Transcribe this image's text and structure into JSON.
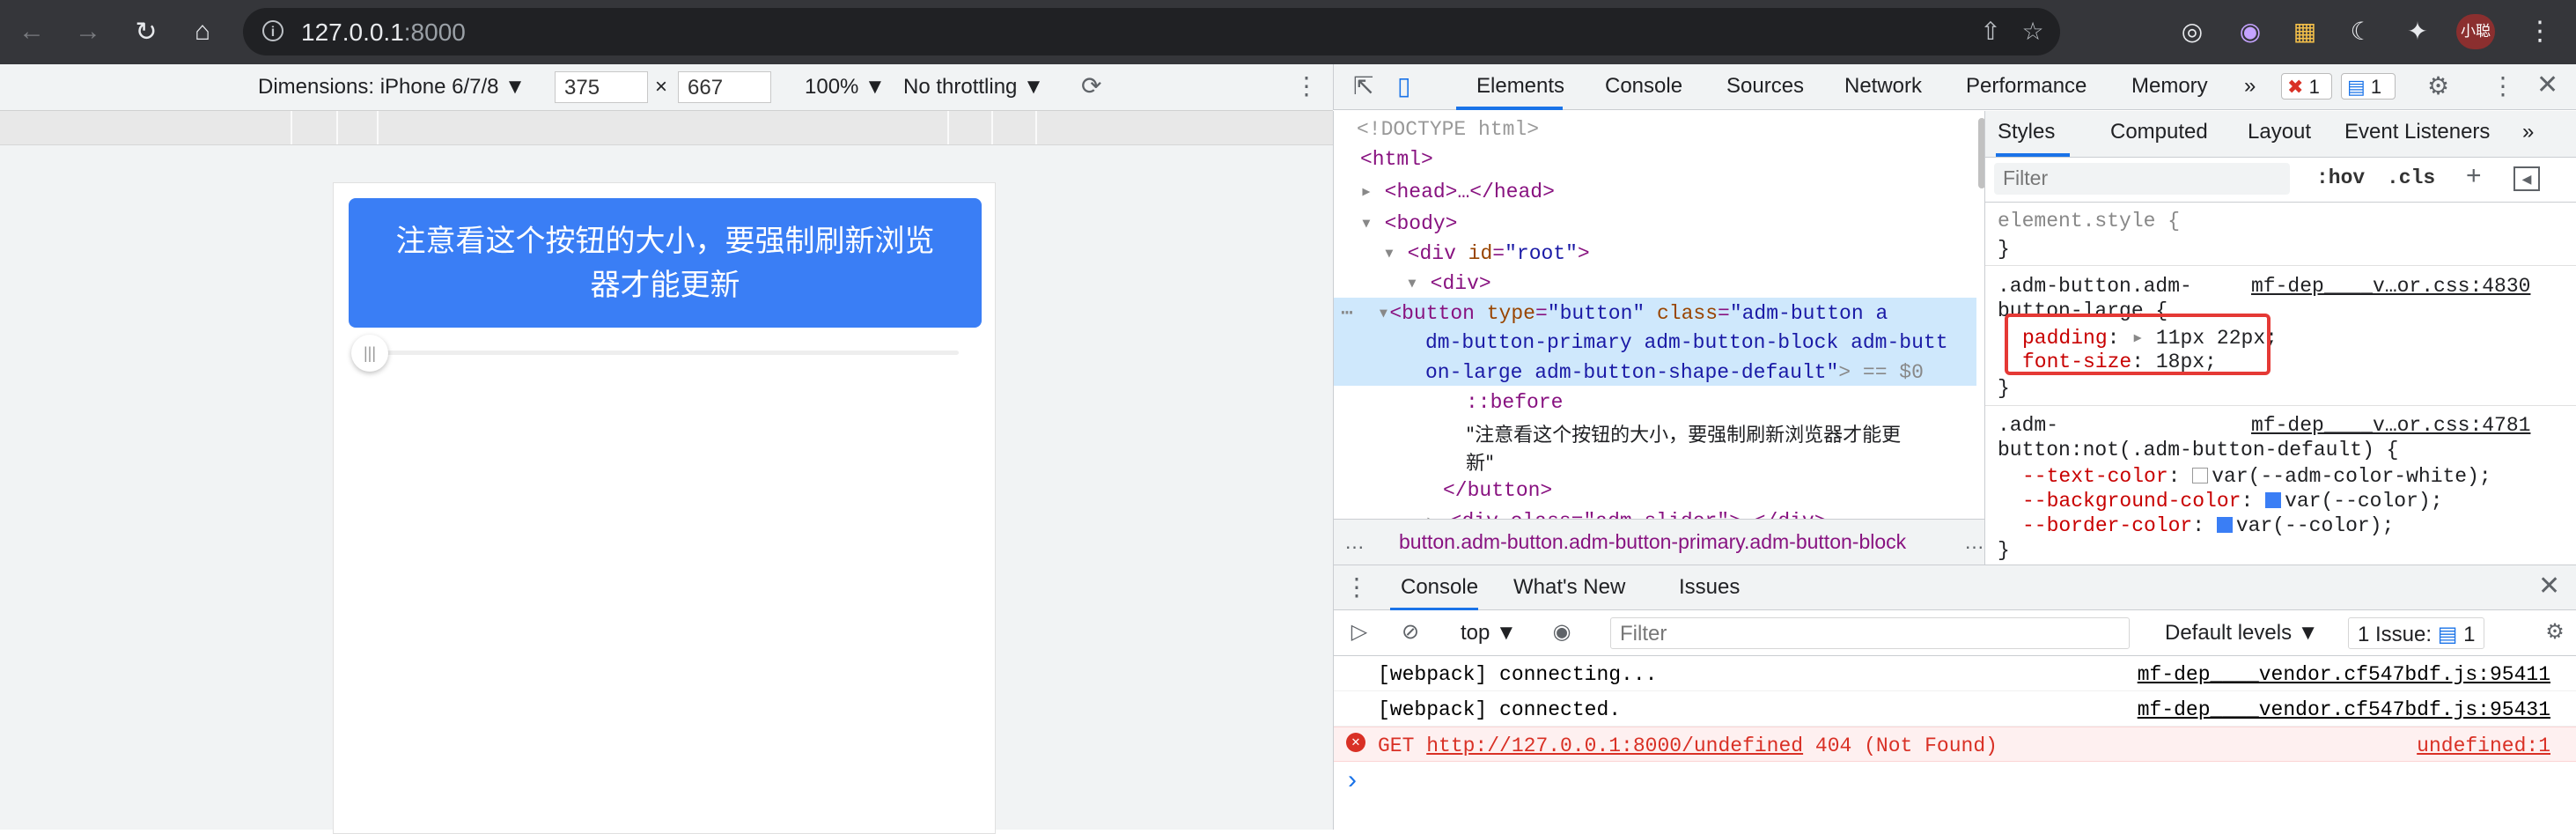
{
  "browser": {
    "url_host": "127.0.0.1",
    "url_port": ":8000",
    "avatar_label": "小聪"
  },
  "device_toolbar": {
    "dimensions_label": "Dimensions: iPhone 6/7/8 ▼",
    "width": "375",
    "times": "×",
    "height": "667",
    "zoom": "100% ▼",
    "throttling": "No throttling ▼"
  },
  "page": {
    "button_text": "注意看这个按钮的大小，要强制刷新浏览器才能更新",
    "slider_thumb": "|||"
  },
  "devtools": {
    "tabs": [
      "Elements",
      "Console",
      "Sources",
      "Network",
      "Performance",
      "Memory"
    ],
    "more_tabs": "»",
    "error_count": "1",
    "message_count": "1",
    "elements": {
      "doctype": "<!DOCTYPE html>",
      "html_open": "<html>",
      "head": "<head>…</head>",
      "body_open": "<body>",
      "div_root_tag": "<div ",
      "div_root_attr": "id",
      "div_root_val": "\"root\"",
      "div_root_close": ">",
      "div_open": "<div>",
      "button_line1_tag": "<button ",
      "button_line1_attr1": "type",
      "button_line1_val1": "\"button\"",
      "button_line1_attr2": " class",
      "button_line1_val2": "\"adm-button a",
      "button_line2": "dm-button-primary adm-button-block adm-butt",
      "button_line3": "on-large adm-button-shape-default\"",
      "button_line3_end": "> == $0",
      "before": "::before",
      "text_node_1": "\"注意看这个按钮的大小，要强制刷新浏览器才能更",
      "text_node_2": "新\"",
      "button_close": "</button>",
      "slider_div": "<div class=\"adm-slider\">…</div>",
      "breadcrumb": "button.adm-button.adm-button-primary.adm-button-block",
      "ellipsis": "…"
    },
    "styles": {
      "tabs": [
        "Styles",
        "Computed",
        "Layout",
        "Event Listeners"
      ],
      "more": "»",
      "filter_placeholder": "Filter",
      "hov": ":hov",
      "cls": ".cls",
      "plus": "+",
      "element_style": "element.style {",
      "close_brace": "}",
      "rule1_selector_a": ".adm-button.adm-",
      "rule1_selector_b": "button-large {",
      "rule1_source": "mf-dep____v…or.css:4830",
      "rule1_prop1": "padding",
      "rule1_val1": "11px 22px;",
      "rule1_prop2": "font-size",
      "rule1_val2": "18px;",
      "rule2_selector_a": ".adm-",
      "rule2_selector_b": "button:not(.adm-button-default) {",
      "rule2_source": "mf-dep____v…or.css:4781",
      "rule2_prop1": "--text-color",
      "rule2_val1": "var(--adm-color-white);",
      "rule2_prop2": "--background-color",
      "rule2_val2": "var(--color);",
      "rule2_prop3": "--border-color",
      "rule2_val3": "var(--color);"
    },
    "drawer": {
      "tabs": [
        "Console",
        "What's New",
        "Issues"
      ],
      "context": "top ▼",
      "filter_placeholder": "Filter",
      "levels": "Default levels ▼",
      "issues": "1 Issue:",
      "issues_count": "1",
      "messages": [
        {
          "text": "[webpack] connecting...",
          "source": "mf-dep____vendor.cf547bdf.js:95411"
        },
        {
          "text": "[webpack] connected.",
          "source": "mf-dep____vendor.cf547bdf.js:95431"
        }
      ],
      "error": {
        "method": "GET ",
        "url": "http://127.0.0.1:8000/undefined",
        "status": " 404 (Not Found)",
        "source": "undefined:1"
      },
      "prompt": "›"
    }
  },
  "colors": {
    "button_blue": "#3a7ef5",
    "highlight_red": "#e53935",
    "selected_row": "#cfe8fc"
  }
}
